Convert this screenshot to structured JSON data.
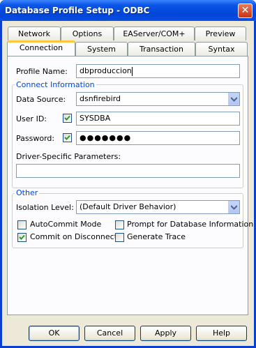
{
  "window": {
    "title": "Database Profile Setup - ODBC",
    "close_glyph": "✕"
  },
  "tabs_row1": [
    "Network",
    "Options",
    "EAServer/COM+",
    "Preview"
  ],
  "tabs_row2": [
    "Connection",
    "System",
    "Transaction",
    "Syntax"
  ],
  "form": {
    "profile_name_label": "Profile Name:",
    "profile_name_value": "dbproduccion",
    "connect_group": "Connect Information",
    "data_source_label": "Data Source:",
    "data_source_value": "dsnfirebird",
    "user_id_label": "User ID:",
    "user_id_value": "SYSDBA",
    "user_id_checked": true,
    "password_label": "Password:",
    "password_value": "●●●●●●●",
    "password_checked": true,
    "driver_params_label": "Driver-Specific Parameters:",
    "driver_params_value": "",
    "other_group": "Other",
    "isolation_label": "Isolation Level:",
    "isolation_value": "(Default Driver Behavior)",
    "autocommit_label": "AutoCommit Mode",
    "autocommit_checked": false,
    "prompt_label": "Prompt for Database Information",
    "prompt_checked": false,
    "commit_disconnect_label": "Commit on Disconnect",
    "commit_disconnect_checked": true,
    "generate_trace_label": "Generate Trace",
    "generate_trace_checked": false
  },
  "buttons": {
    "ok": "OK",
    "cancel": "Cancel",
    "apply": "Apply",
    "help": "Help"
  },
  "colors": {
    "title_blue": "#0a55e6",
    "group_title": "#0046d5",
    "tab_highlight": "#ffc83c",
    "check_green": "#21a121"
  }
}
